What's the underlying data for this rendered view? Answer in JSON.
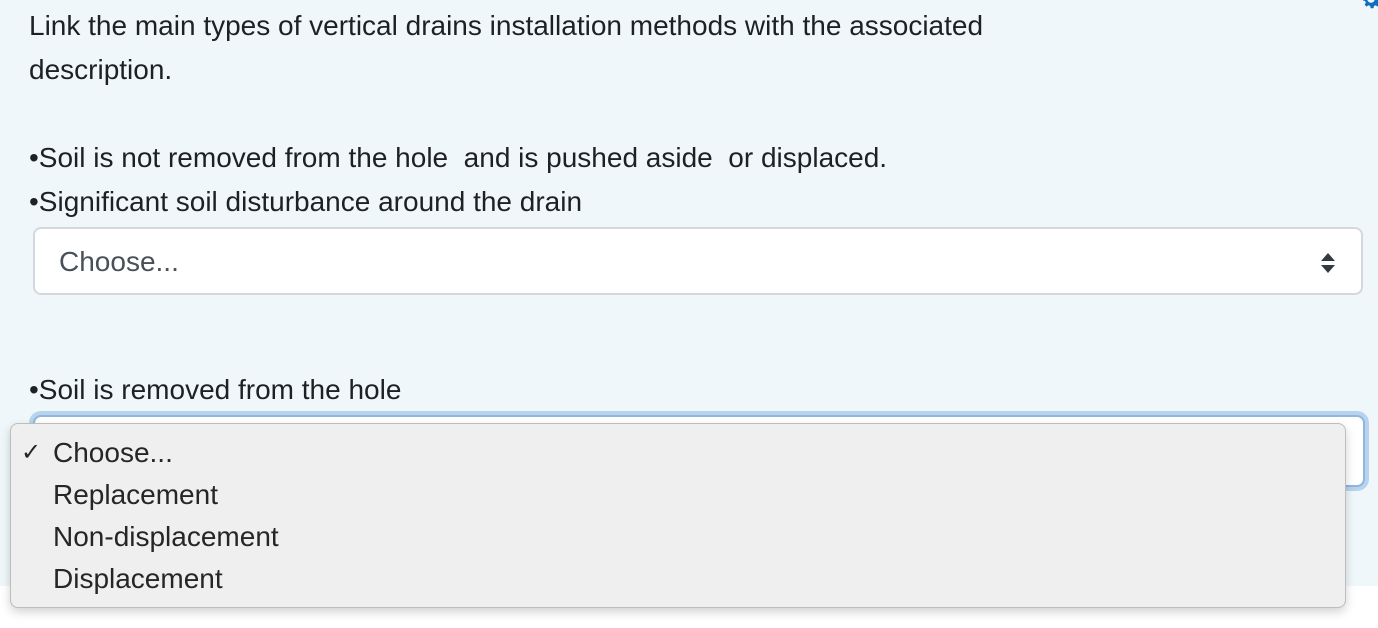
{
  "question": {
    "prompt": "Link the main types of vertical drains installation methods with the associated description."
  },
  "item1": {
    "line1": "•Soil is not removed from the hole  and is pushed aside  or displaced.",
    "line2": "•Significant soil disturbance around the drain",
    "select_value": "Choose..."
  },
  "item2": {
    "line1": "•Soil is removed from the hole"
  },
  "dropdown": {
    "check_mark": "✓",
    "options": [
      {
        "label": "Choose...",
        "selected": true
      },
      {
        "label": "Replacement",
        "selected": false
      },
      {
        "label": "Non-displacement",
        "selected": false
      },
      {
        "label": "Displacement",
        "selected": false
      }
    ]
  },
  "icons": {
    "corner": "gear-icon",
    "select_arrows": "sort-arrows-icon",
    "accent_color": "#0f6cbf"
  }
}
